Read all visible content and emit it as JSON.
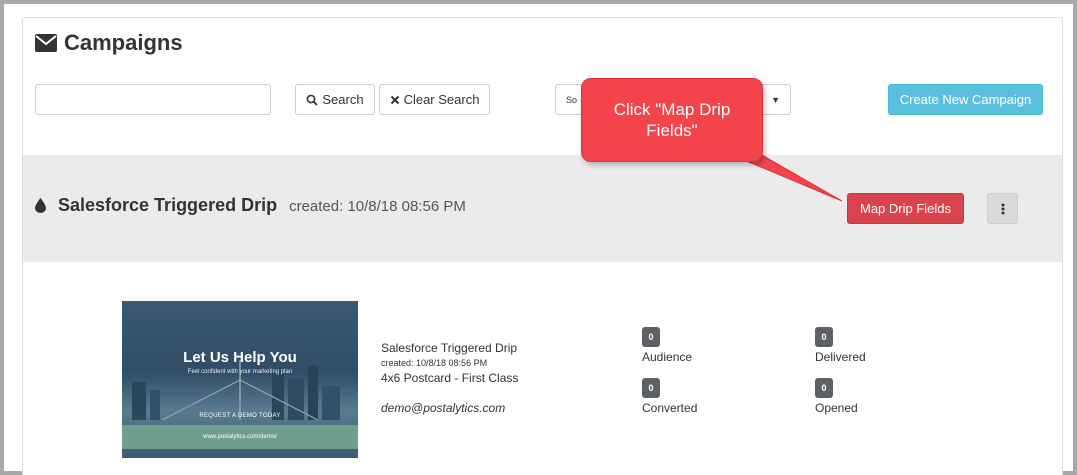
{
  "header": {
    "title": "Campaigns",
    "icon": "envelope-icon"
  },
  "toolbar": {
    "search_value": "",
    "search_label": "Search",
    "clear_label": "Clear Search",
    "sort_value": "So",
    "create_label": "Create New Campaign"
  },
  "drip": {
    "name": "Salesforce Triggered Drip",
    "created": "created: 10/8/18 08:56 PM",
    "map_label": "Map Drip Fields"
  },
  "card": {
    "thumbnail": {
      "headline": "Let Us Help You",
      "subline": "Feel confident with your marketing plan",
      "cta": "REQUEST A DEMO TODAY",
      "url": "www.postalytics.com/demo/"
    },
    "name": "Salesforce Triggered Drip",
    "created": "created: 10/8/18 08:56 PM",
    "format": "4x6 Postcard - First Class",
    "email": "demo@postalytics.com"
  },
  "stats": [
    {
      "label": "Audience",
      "value": "0"
    },
    {
      "label": "Delivered",
      "value": "0"
    },
    {
      "label": "Converted",
      "value": "0"
    },
    {
      "label": "Opened",
      "value": "0"
    }
  ],
  "callout": {
    "text": "Click \"Map Drip Fields\""
  },
  "colors": {
    "primary_info": "#5bc0de",
    "danger": "#d9434c",
    "callout": "#f2444a",
    "badge": "#5d6166"
  }
}
